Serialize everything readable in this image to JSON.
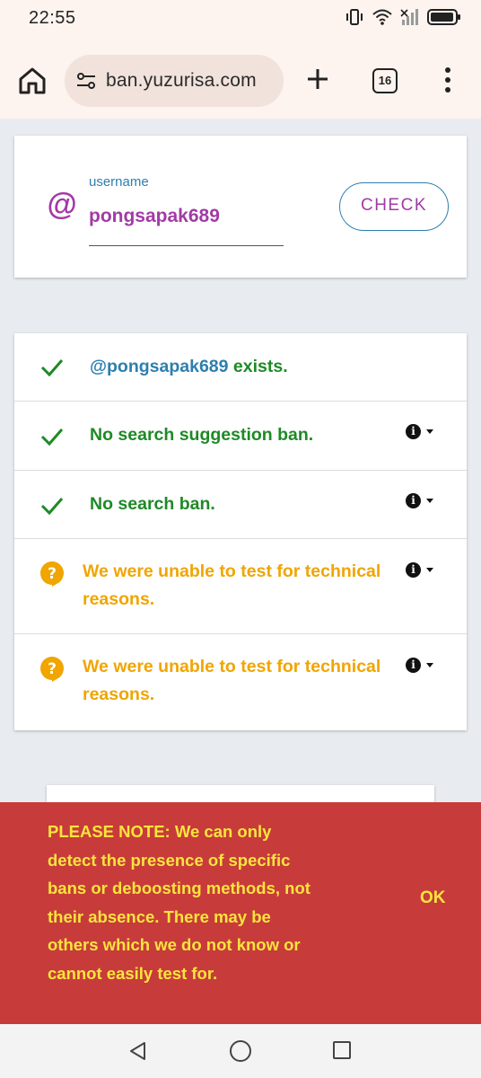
{
  "status_bar": {
    "time": "22:55"
  },
  "browser": {
    "url": "ban.yuzurisa.com",
    "tab_count": "16"
  },
  "form": {
    "label": "username",
    "value": "pongsapak689",
    "at_symbol": "@",
    "check_label": "CHECK"
  },
  "results": [
    {
      "icon": "check-icon",
      "prefix": "@pongsapak689",
      "text": " exists.",
      "status": "ok",
      "has_info": false
    },
    {
      "icon": "check-icon",
      "text": "No search suggestion ban.",
      "status": "ok",
      "has_info": true
    },
    {
      "icon": "check-icon",
      "text": "No search ban.",
      "status": "ok",
      "has_info": true
    },
    {
      "icon": "question-icon",
      "text": "We were unable to test for technical reasons.",
      "status": "unknown",
      "has_info": true
    },
    {
      "icon": "question-icon",
      "text": "We were unable to test for technical reasons.",
      "status": "unknown",
      "has_info": true
    }
  ],
  "snackbar": {
    "message": "PLEASE NOTE: We can only detect the presence of specific bans or deboosting methods, not their absence. There may be others which we do not know or cannot easily test for.",
    "action": "OK"
  },
  "colors": {
    "accent": "#a23aa6",
    "link": "#2d7fae",
    "ok": "#1e8a26",
    "warn": "#f0a500",
    "snackbar_bg": "#c83b3b",
    "snackbar_text": "#f8e53c"
  }
}
